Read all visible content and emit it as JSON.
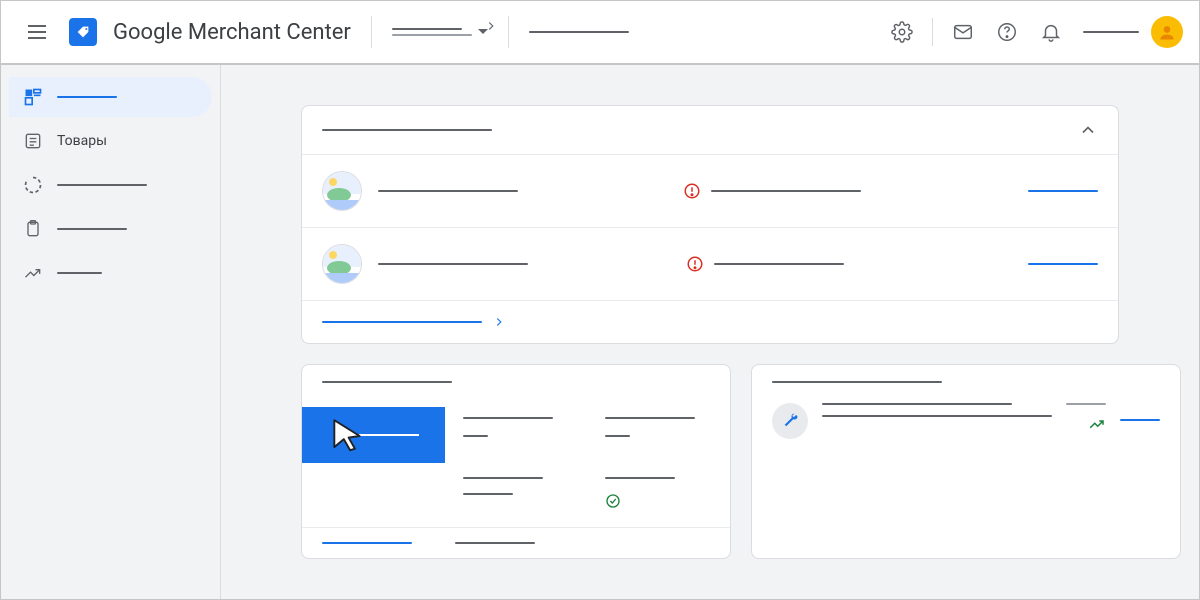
{
  "header": {
    "app_title": "Google Merchant Center",
    "selector_label": "",
    "breadcrumb_label": "",
    "search_label": "",
    "account_label": ""
  },
  "sidebar": {
    "items": [
      {
        "label": "",
        "active": true
      },
      {
        "label": "Товары",
        "active": false
      },
      {
        "label": "",
        "active": false
      },
      {
        "label": "",
        "active": false
      },
      {
        "label": "",
        "active": false
      }
    ]
  },
  "card_issues": {
    "title": "",
    "rows": [
      {
        "name": "",
        "status": "",
        "action": ""
      },
      {
        "name": "",
        "status": "",
        "action": ""
      }
    ],
    "footer_link": ""
  },
  "card_channels": {
    "title": "",
    "tabs": [
      {
        "label": "",
        "selected": true
      },
      {
        "label": "",
        "selected": false
      },
      {
        "label": "",
        "selected": false
      }
    ],
    "row2": [
      {
        "metric": "",
        "value": ""
      },
      {
        "metric": "",
        "value": ""
      }
    ],
    "bottom_link": "",
    "bottom_metric": "",
    "bottom_status": ""
  },
  "card_opportunities": {
    "title": "",
    "item_title": "",
    "item_desc": "",
    "item_meta": "",
    "item_action": ""
  },
  "icons": {
    "hamburger": "menu-icon",
    "settings": "gear-icon",
    "mail": "mail-icon",
    "help": "help-icon",
    "notifications": "bell-icon",
    "avatar": "person-icon"
  },
  "colors": {
    "primary": "#1a73e8",
    "error": "#d93025",
    "success": "#188038",
    "accent_yellow": "#fbbc04"
  }
}
